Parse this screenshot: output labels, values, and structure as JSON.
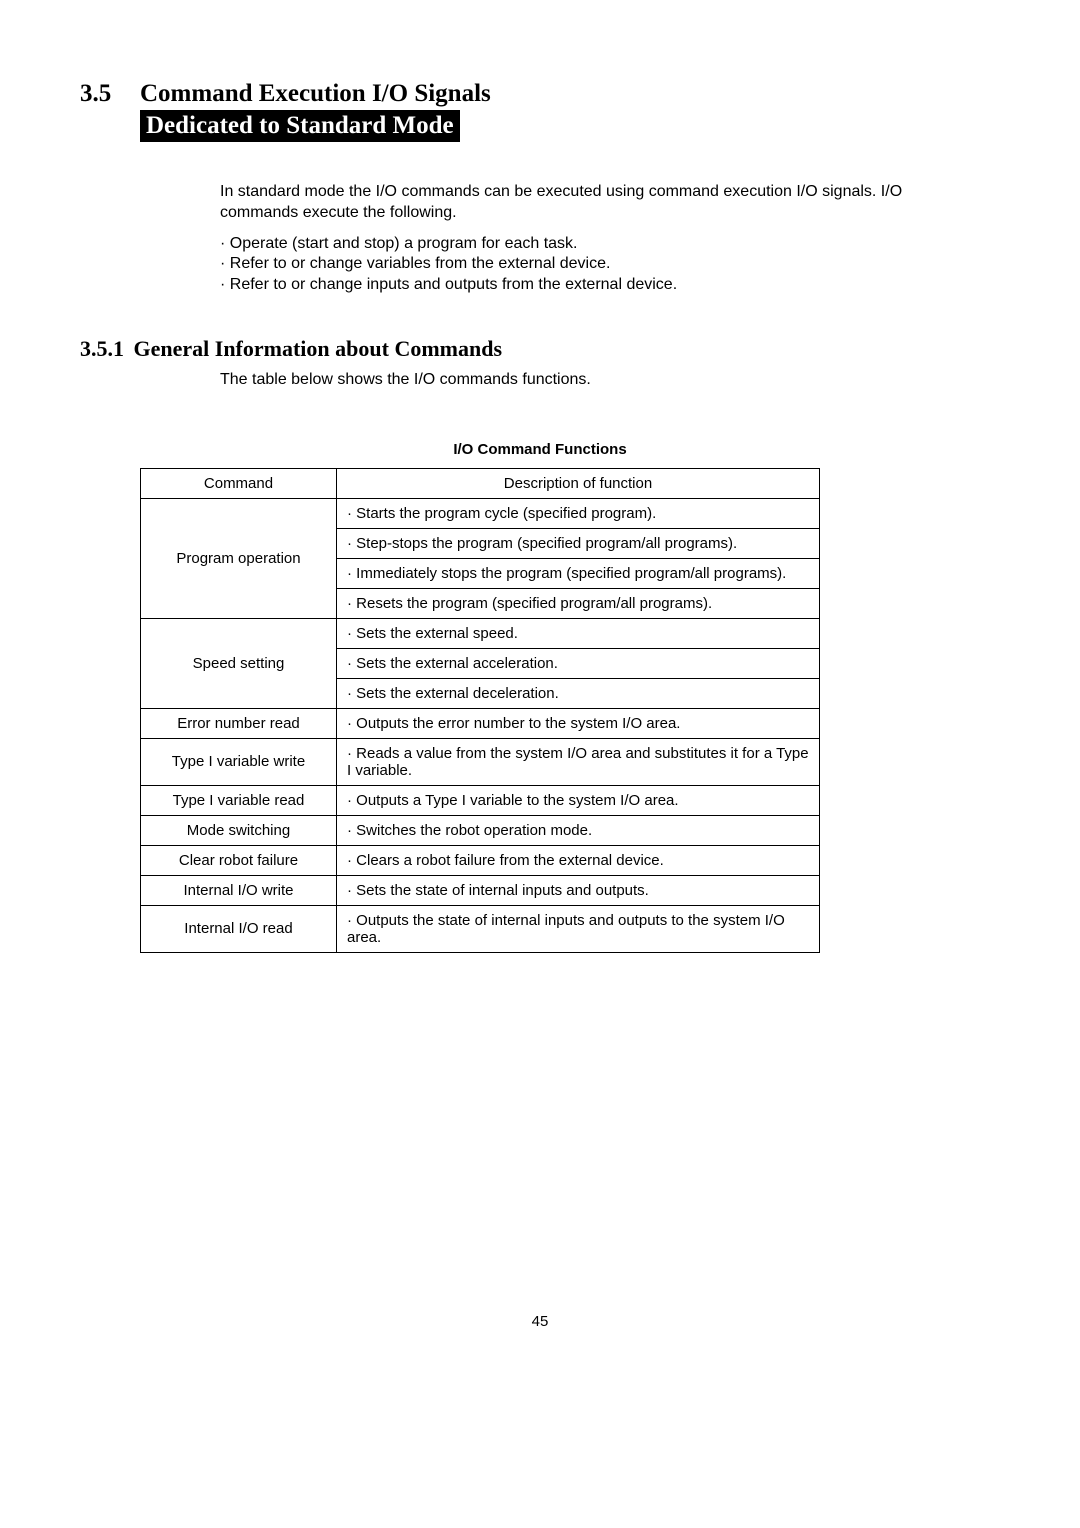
{
  "heading": {
    "number": "3.5",
    "title": "Command Execution I/O Signals",
    "subtitle": "Dedicated to Standard Mode"
  },
  "intro": {
    "para": "In standard mode the I/O commands can be executed using command execution I/O signals. I/O commands execute the following.",
    "b1": "· Operate (start and stop) a program for each task.",
    "b2": "· Refer to or change variables from the external device.",
    "b3": "· Refer to or change inputs and outputs from the external device."
  },
  "sub": {
    "number": "3.5.1",
    "title": "General Information about Commands",
    "para": "The table below shows the I/O commands functions."
  },
  "table": {
    "caption": "I/O Command Functions",
    "head_cmd": "Command",
    "head_desc": "Description of function",
    "r1c1": "Program operation",
    "r1d1": "· Starts the program cycle (specified program).",
    "r1d2": "· Step-stops the program (specified program/all programs).",
    "r1d3": "· Immediately stops the program (specified program/all programs).",
    "r1d4": "· Resets the program (specified program/all programs).",
    "r2c1": "Speed setting",
    "r2d1": "· Sets the external speed.",
    "r2d2": "· Sets the external acceleration.",
    "r2d3": "· Sets the external deceleration.",
    "r3c1": "Error number read",
    "r3d1": "· Outputs the error number to the system I/O area.",
    "r4c1": "Type I variable write",
    "r4d1": "· Reads a value from the system I/O area and substitutes it for a Type I variable.",
    "r5c1": "Type I variable read",
    "r5d1": "· Outputs a Type I variable to the system I/O area.",
    "r6c1": "Mode switching",
    "r6d1": "· Switches the robot operation mode.",
    "r7c1": "Clear robot failure",
    "r7d1": "· Clears a robot failure from the external device.",
    "r8c1": "Internal I/O write",
    "r8d1": "· Sets the state of internal inputs and outputs.",
    "r9c1": "Internal I/O read",
    "r9d1": "· Outputs the state of internal inputs and outputs to the system I/O area."
  },
  "page_number": "45"
}
